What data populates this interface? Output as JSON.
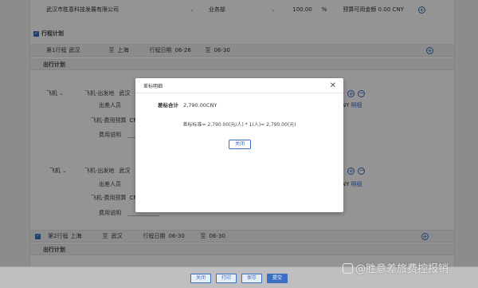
{
  "top_row": {
    "company": "武汉市胜意科技发展有限公司",
    "department": "业务部",
    "percent_value": "100.00",
    "percent_sign": "%",
    "budget_text": "预算可用金额 0.00 CNY"
  },
  "itinerary_section": {
    "title": "行程计划"
  },
  "trip1": {
    "label": "第1行程",
    "from": "武汉",
    "to_label": "至",
    "to": "上海",
    "date_label": "行程日期",
    "date_from": "06-26",
    "date_to_label": "至",
    "date_to": "06-30"
  },
  "travel_plan_1": {
    "title": "出行计划"
  },
  "transport_1": {
    "mode": "飞机",
    "depart_arrive_label": "飞机-出发地",
    "depart_value": "武汉",
    "traveler_label": "出差人员",
    "budget_label": "飞机-费用预算",
    "budget_value": "CNY",
    "description_label": "费用说明",
    "amount_currency": "CNY",
    "detail_link": "明细"
  },
  "transport_2": {
    "mode": "飞机",
    "depart_arrive_label": "飞机-出发地",
    "depart_value": "武汉",
    "traveler_label": "出差人员",
    "budget_label": "飞机-费用预算",
    "budget_value": "CNY",
    "description_label": "费用说明",
    "amount_currency": "CNY",
    "detail_link": "明细"
  },
  "trip2": {
    "label": "第2行程",
    "from": "上海",
    "to_label": "至",
    "to": "武汉",
    "date_label": "行程日期",
    "date_from": "06-30",
    "date_to_label": "至",
    "date_to": "06-30"
  },
  "travel_plan_2": {
    "title": "出行计划"
  },
  "modal": {
    "title": "差标明细",
    "total_label": "差标合计",
    "total_value": "2,790.00CNY",
    "formula": "差标标准= 2,790.00(元/人) * 1(人)= 2,790.00(元)",
    "close_button": "关闭"
  },
  "bottom_buttons": {
    "close": "关闭",
    "print": "打印",
    "save": "保存",
    "submit": "提交"
  },
  "watermark": "@胜意差旅费控报销",
  "colors": {
    "accent": "#3a6fc2",
    "overlay": "rgba(0,0,0,0.42)"
  }
}
